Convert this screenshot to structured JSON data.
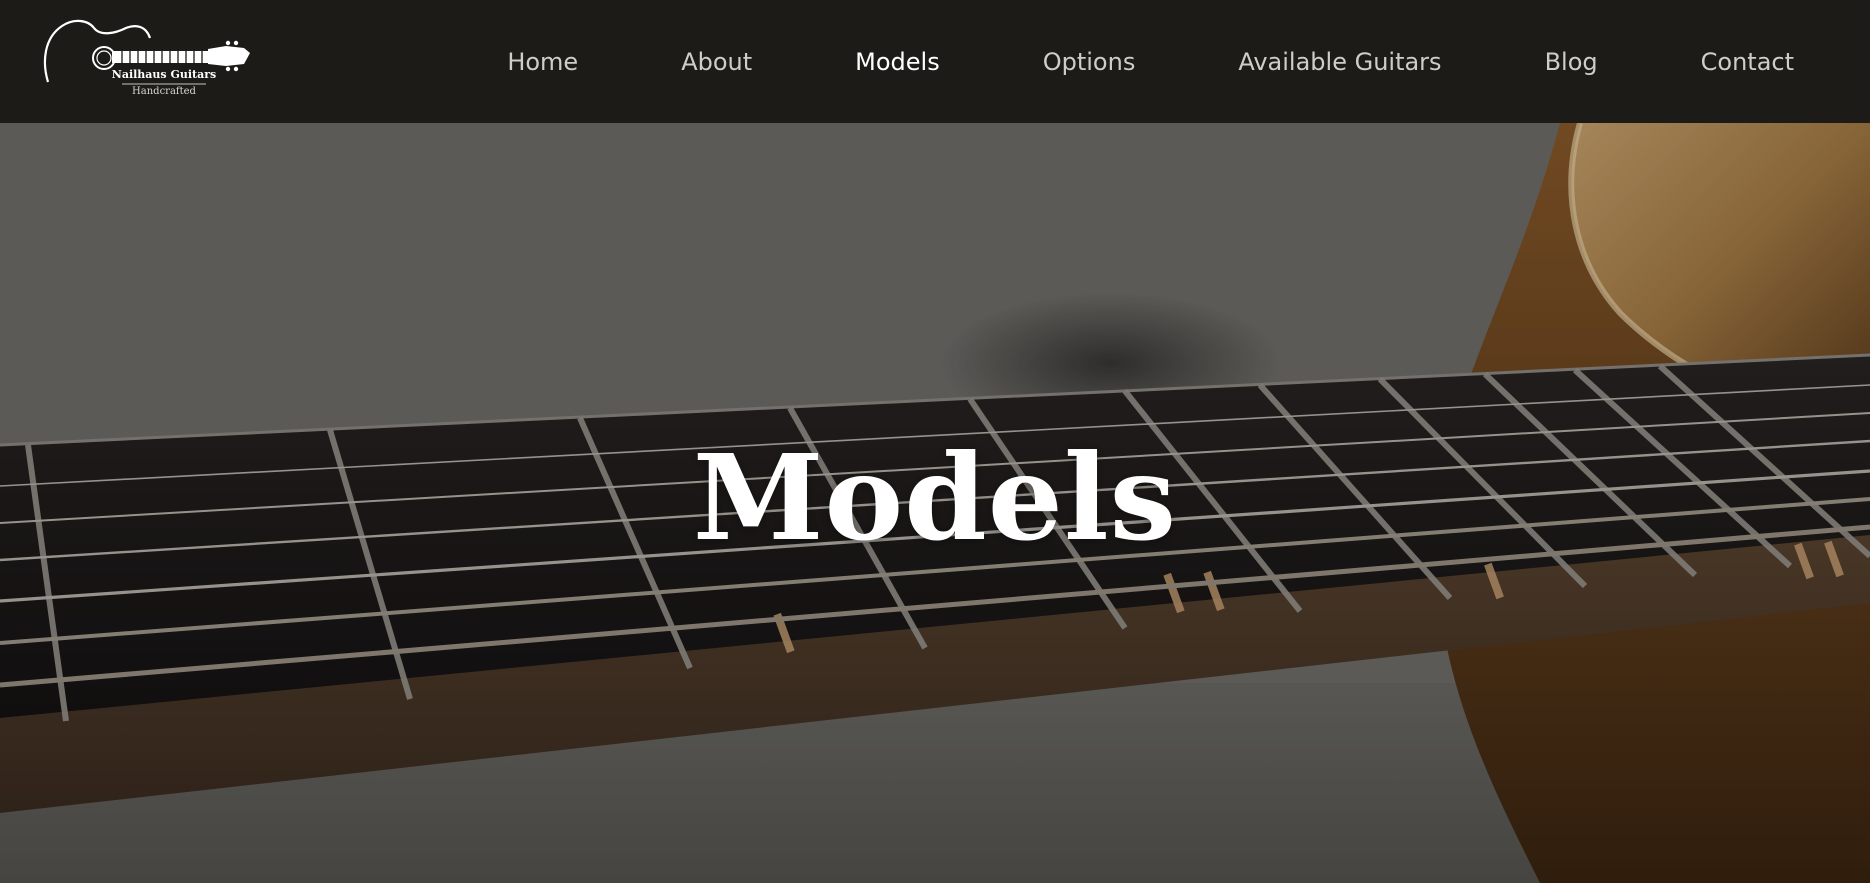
{
  "brand": {
    "name": "Nailhaus Guitars",
    "tagline": "Handcrafted"
  },
  "nav": {
    "items": [
      {
        "label": "Home"
      },
      {
        "label": "About"
      },
      {
        "label": "Models",
        "active": true
      },
      {
        "label": "Options"
      },
      {
        "label": "Available Guitars"
      },
      {
        "label": "Blog"
      },
      {
        "label": "Contact"
      }
    ]
  },
  "hero": {
    "title": "Models",
    "image": "guitar-fretboard-photo"
  },
  "colors": {
    "header_bg": "#1c1b17",
    "nav_text": "#cfcdc8",
    "nav_active": "#ffffff",
    "hero_title": "#ffffff"
  }
}
